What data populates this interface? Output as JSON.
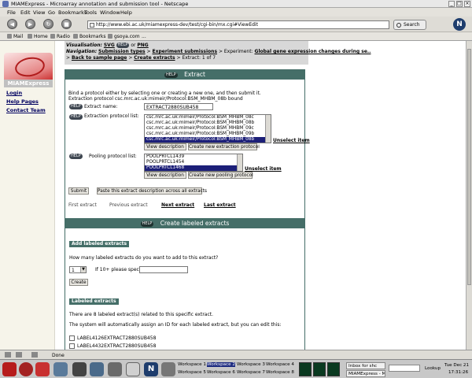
{
  "window": {
    "title": "MIAMExpress - Microarray annotation and submission tool - Netscape"
  },
  "menu": [
    "File",
    "Edit",
    "View",
    "Go",
    "Bookmarks",
    "Tools",
    "Window",
    "Help"
  ],
  "nav": {
    "url": "http://www.ebi.ac.uk/miamexpress-dev/test/cgi-bin/mx.cgi#ViewEdit",
    "search_label": "Search"
  },
  "bookmarks": [
    "Mail",
    "Home",
    "Radio",
    "Bookmarks",
    "gsoya.com",
    "..."
  ],
  "sidebar": {
    "logo_text": "MIAMExpress",
    "links": [
      "Login",
      "Help Pages",
      "Contact Team"
    ]
  },
  "crumbs": {
    "visualisation_label": "Visualisation:",
    "svg": "SVG",
    "or": "or",
    "png": "PNG",
    "navigation_label": "Navigation:",
    "items": [
      "Submission types",
      "Experiment submissions",
      "Experiment:",
      "Global gene expression changes during se..",
      "Back to sample page",
      "Create extracts"
    ],
    "current": "Extract: 1 of 7",
    "sep": ">"
  },
  "extract_panel": {
    "title": "Extract",
    "help": "HELP",
    "intro_line1": "Bind a protocol either by selecting one or creating a new one, and then submit it.",
    "intro_line2": "Extraction protocol csc.mrc.ac.uk:mimeir/Protocol:BSM_MHBM_08b bound",
    "extract_name_label": "Extract name:",
    "extract_name_value": "EXTRACT2880SUB458",
    "extraction_protocol_label": "Extraction protocol list:",
    "extraction_options": [
      "csc.mrc.ac.uk:mimeir/Protocol:BSM_MHBM_08c",
      "csc.mrc.ac.uk:mimeir/Protocol:BSM_MHBM_08b",
      "csc.mrc.ac.uk:mimeir/Protocol:BSM_MHBM_09c",
      "csc.mrc.ac.uk:mimeir/Protocol:BSM_MHBM_09b",
      "csc.mrc.ac.uk:mimeir/Protocol:BSM_MHBM_08b"
    ],
    "extraction_selected_index": 4,
    "view_description": "View description",
    "create_extraction_protocol": "Create new extraction protocol",
    "unselect_item": "Unselect item",
    "pooling_protocol_label": "Pooling protocol list:",
    "pooling_options": [
      "POOLPRTCL1439",
      "POOLPRTCL1454",
      "POOLPRTCL1468"
    ],
    "pooling_selected_index": 2,
    "create_pooling_protocol": "Create new pooling protocol",
    "submit": "Submit",
    "paste_all": "Paste this extract description across all extracts",
    "first_extract": "First extract",
    "previous_extract": "Previous extract",
    "next_extract": "Next extract",
    "last_extract": "Last extract"
  },
  "labeled_panel": {
    "title": "Create labeled extracts",
    "help": "HELP",
    "add_header": "Add labeled extracts",
    "question": "How many labeled extracts do you want to add to this extract?",
    "count_value": "1",
    "if_more_label": "If 10+ please specify:",
    "create": "Create",
    "labeled_header": "Labeled extracts",
    "related_text": "There are 8 labeled extract(s) related to this specific extract.",
    "auto_text": "The system will automatically assign an ID for each labeled extract, but you can edit this:",
    "items": [
      "LABEL4126EXTRACT2880SUB458",
      "LABEL4432EXTRACT2880SUB458"
    ]
  },
  "statusbar": {
    "text": "Done"
  },
  "taskbar": {
    "workspaces": [
      "Workspace 1",
      "Workspace 2",
      "Workspace 3",
      "Workspace 4",
      "Workspace 5",
      "Workspace 6",
      "Workspace 7",
      "Workspace 8"
    ],
    "active_workspace": 1,
    "tasks": [
      "Inbox for shc",
      "MIAMExpress - Mic"
    ],
    "lookup": "Lookup",
    "date": "Tue Dec 21",
    "time": "17:31:26"
  }
}
